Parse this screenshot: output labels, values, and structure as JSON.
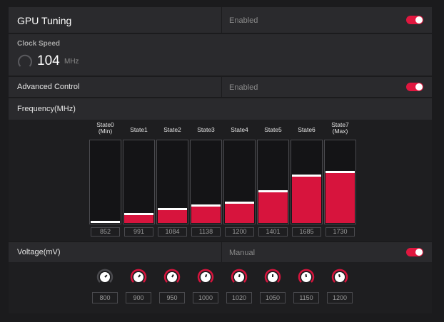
{
  "gpu_tuning": {
    "title": "GPU Tuning",
    "status": "Enabled",
    "toggle_on": true
  },
  "clock": {
    "label": "Clock Speed",
    "value": "104",
    "unit": "MHz"
  },
  "advanced": {
    "title": "Advanced Control",
    "status": "Enabled",
    "toggle_on": true
  },
  "frequency": {
    "title": "Frequency(MHz)",
    "states": [
      {
        "name_line1": "State0",
        "name_line2": "(Min)",
        "value": "852",
        "level": 0.02
      },
      {
        "name_line1": "",
        "name_line2": "State1",
        "value": "991",
        "level": 0.12
      },
      {
        "name_line1": "",
        "name_line2": "State2",
        "value": "1084",
        "level": 0.18
      },
      {
        "name_line1": "",
        "name_line2": "State3",
        "value": "1138",
        "level": 0.22
      },
      {
        "name_line1": "",
        "name_line2": "State4",
        "value": "1200",
        "level": 0.26
      },
      {
        "name_line1": "",
        "name_line2": "State5",
        "value": "1401",
        "level": 0.39
      },
      {
        "name_line1": "",
        "name_line2": "State6",
        "value": "1685",
        "level": 0.58
      },
      {
        "name_line1": "State7",
        "name_line2": "(Max)",
        "value": "1730",
        "level": 0.62
      }
    ]
  },
  "voltage": {
    "title": "Voltage(mV)",
    "status": "Manual",
    "toggle_on": true,
    "knobs": [
      {
        "value": "800",
        "active": false
      },
      {
        "value": "900",
        "active": true
      },
      {
        "value": "950",
        "active": true
      },
      {
        "value": "1000",
        "active": true
      },
      {
        "value": "1020",
        "active": true
      },
      {
        "value": "1050",
        "active": true
      },
      {
        "value": "1150",
        "active": true
      },
      {
        "value": "1200",
        "active": true
      }
    ]
  },
  "colors": {
    "accent": "#d7143d",
    "toggle": "#e0173f",
    "panel": "#2a2a2d",
    "background": "#1b1b1d"
  }
}
